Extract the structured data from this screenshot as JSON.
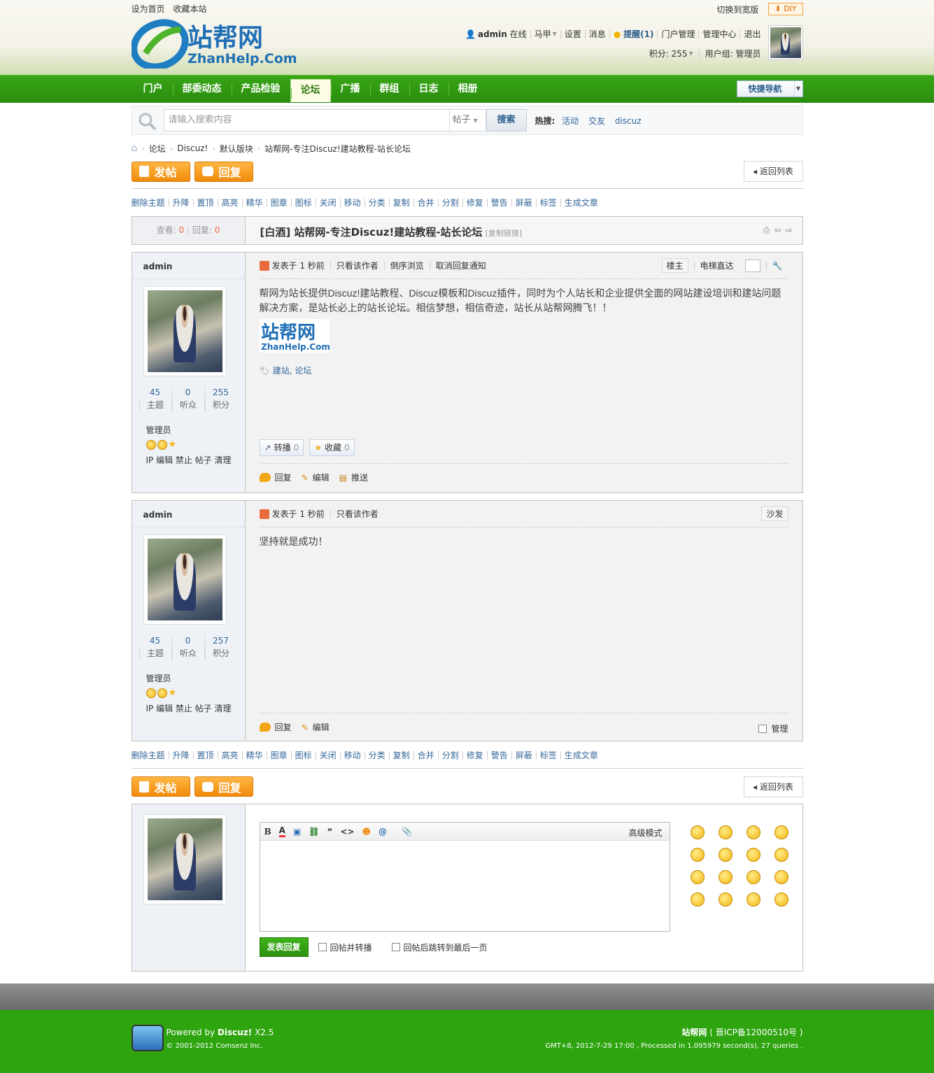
{
  "top": {
    "set_home": "设为首页",
    "favorite": "收藏本站",
    "switch_wide": "切换到宽版",
    "diy": "DIY"
  },
  "logo": {
    "cn": "站帮网",
    "en": "ZhanHelp.Com"
  },
  "user": {
    "name": "admin",
    "status": "在线",
    "vest": "马甲",
    "settings": "设置",
    "messages": "消息",
    "remind": "提醒(1)",
    "portal_admin": "门户管理",
    "admin_center": "管理中心",
    "logout": "退出",
    "credits": "积分: 255",
    "group": "用户组: 管理员"
  },
  "nav": {
    "items": [
      "门户",
      "部委动态",
      "产品检验",
      "论坛",
      "广播",
      "群组",
      "日志",
      "相册"
    ],
    "active": "论坛",
    "quick_nav": "快捷导航"
  },
  "search": {
    "placeholder": "请输入搜索内容",
    "type": "帖子",
    "button": "搜索",
    "hot_label": "热搜:",
    "hot": [
      "活动",
      "交友",
      "discuz"
    ]
  },
  "breadcrumb": [
    "论坛",
    "Discuz!",
    "默认版块",
    "站帮网-专注Discuz!建站教程-站长论坛"
  ],
  "buttons": {
    "new_post": "发帖",
    "reply": "回复",
    "back_list": "返回列表"
  },
  "modbar": [
    "删除主题",
    "升降",
    "置顶",
    "高亮",
    "精华",
    "图章",
    "图标",
    "关闭",
    "移动",
    "分类",
    "复制",
    "合并",
    "分割",
    "修复",
    "警告",
    "屏蔽",
    "标签",
    "生成文章"
  ],
  "thread": {
    "views_label": "查看:",
    "views": "0",
    "replies_label": "回复:",
    "replies": "0",
    "title": "[白酒] 站帮网-专注Discuz!建站教程-站长论坛",
    "copy_link": "[复制链接]"
  },
  "posts": [
    {
      "author": "admin",
      "posted": "发表于 1 秒前",
      "only_author": "只看该作者",
      "reverse": "倒序浏览",
      "cancel_notify": "取消回复通知",
      "floor": "楼主",
      "jump": "电梯直达",
      "content": "帮网为站长提供Discuz!建站教程、Discuz模板和Discuz插件，同时为个人站长和企业提供全面的网站建设培训和建站问题解决方案，是站长必上的站长论坛。相信梦想，相信奇迹，站长从站帮网腾飞！！",
      "tags": "建站, 论坛",
      "share": "转播",
      "share_count": "0",
      "fav": "收藏",
      "fav_count": "0",
      "reply": "回复",
      "edit": "编辑",
      "push": "推送",
      "stats": [
        {
          "n": "45",
          "l": "主题"
        },
        {
          "n": "0",
          "l": "听众"
        },
        {
          "n": "255",
          "l": "积分"
        }
      ],
      "group": "管理员",
      "ops": "IP 编辑 禁止 帖子 清理"
    },
    {
      "author": "admin",
      "posted": "发表于 1 秒前",
      "only_author": "只看该作者",
      "floor": "沙发",
      "content": "坚持就是成功！",
      "reply": "回复",
      "edit": "编辑",
      "manage": "管理",
      "stats": [
        {
          "n": "45",
          "l": "主题"
        },
        {
          "n": "0",
          "l": "听众"
        },
        {
          "n": "257",
          "l": "积分"
        }
      ],
      "group": "管理员",
      "ops": "IP 编辑 禁止 帖子 清理"
    }
  ],
  "editor": {
    "advanced": "高级模式",
    "submit": "发表回复",
    "opt1": "回帖并转播",
    "opt2": "回帖后跳转到最后一页"
  },
  "footer": {
    "powered": "Powered by",
    "brand": "Discuz!",
    "version": "X2.5",
    "copyright": "© 2001-2012 Comsenz Inc.",
    "site": "站帮网",
    "icp": "( 晋ICP备12000510号 )",
    "gmt": "GMT+8, 2012-7-29 17:00 , Processed in 1.095979 second(s), 27 queries ."
  },
  "colors": {
    "green": "#2ea40f",
    "link": "#336699",
    "orange": "#f08b0b"
  }
}
